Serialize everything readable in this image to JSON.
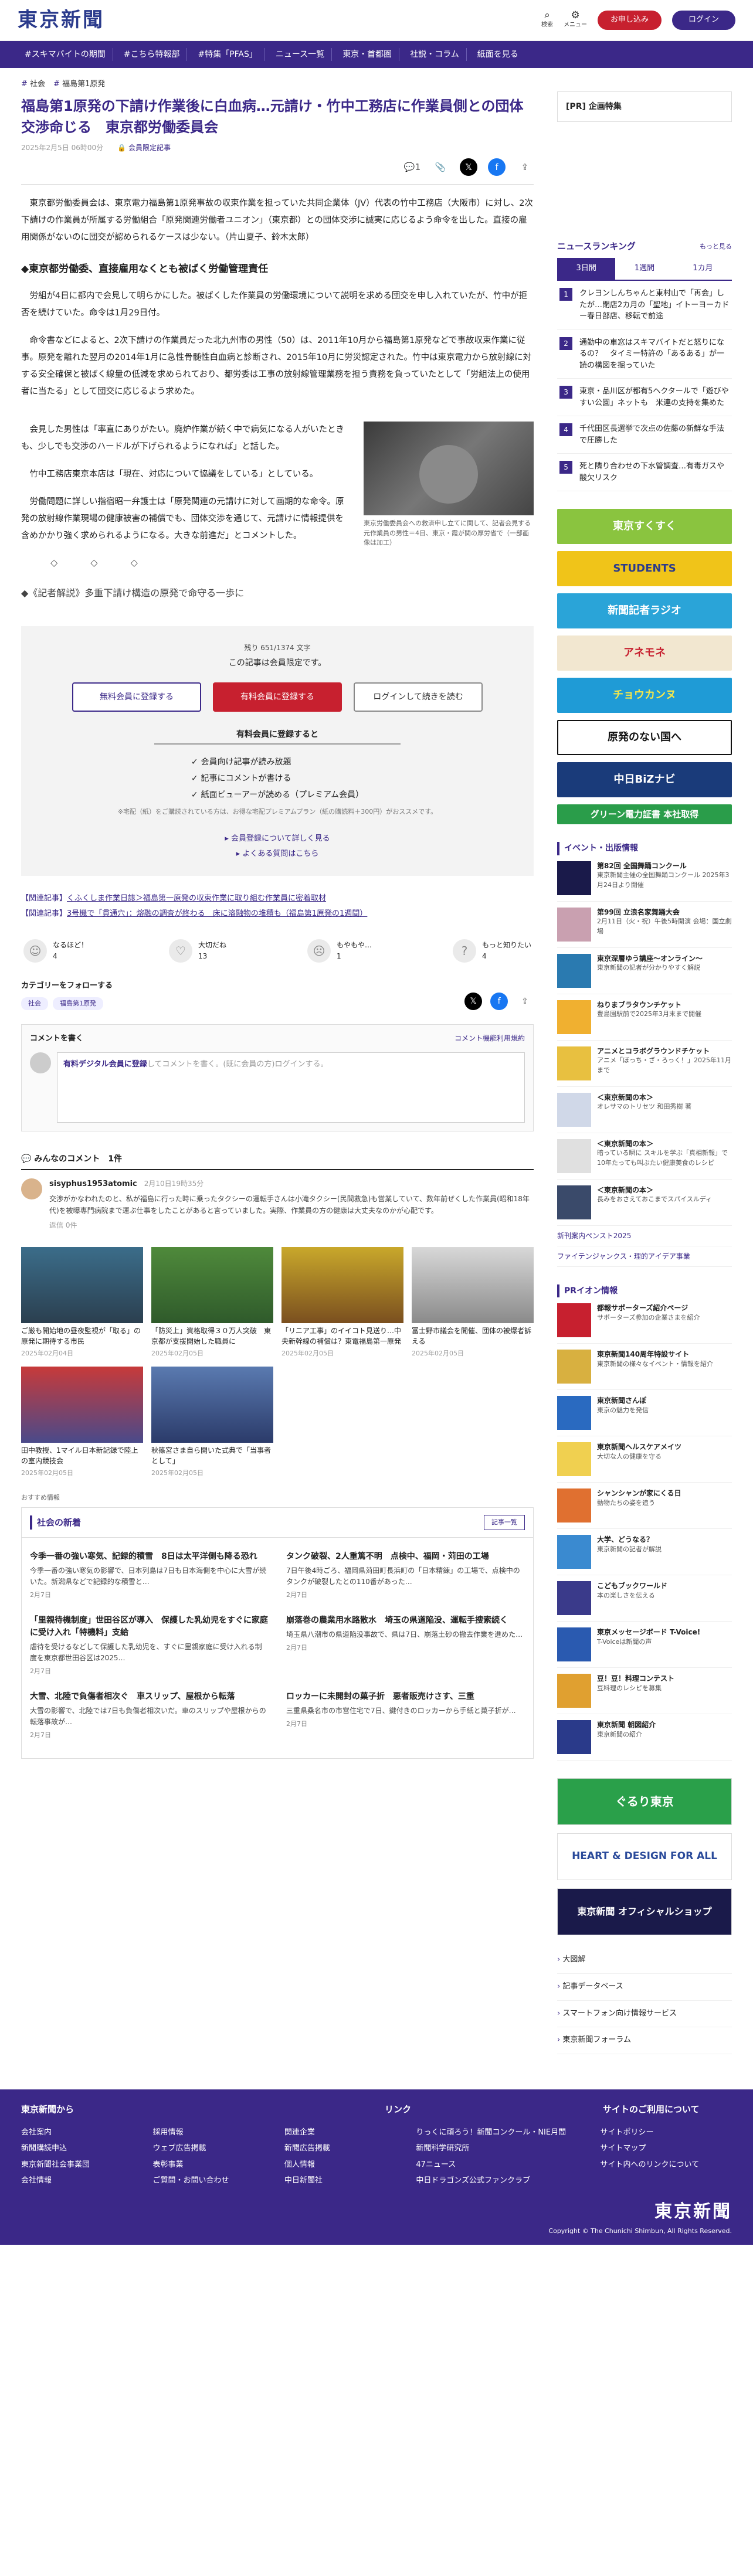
{
  "header": {
    "logo": "東京新聞",
    "search_label": "検索",
    "menu_label": "メニュー",
    "trial_label": "お申し込み",
    "login_label": "ログイン"
  },
  "nav": [
    "#スキマバイトの期間",
    "#こちら特報部",
    "#特集「PFAS」",
    "ニュース一覧",
    "東京・首都圏",
    "社説・コラム",
    "紙面を見る"
  ],
  "article": {
    "breadcrumb": [
      "社会",
      "福島第1原発"
    ],
    "headline": "福島第1原発の下請け作業後に白血病…元請け・竹中工務店に作業員側との団体交渉命じる　東京都労働委員会",
    "date": "2025年2月5日 06時00分",
    "member_badge": "会員限定記事",
    "comment_count": "1",
    "p1": "東京都労働委員会は、東京電力福島第1原発事故の収束作業を担っていた共同企業体（JV）代表の竹中工務店（大阪市）に対し、2次下請けの作業員が所属する労働組合「原発関連労働者ユニオン」（東京都）との団体交渉に誠実に応じるよう命令を出した。直接の雇用関係がないのに団交が認められるケースは少ない。（片山夏子、鈴木太郎）",
    "subhead": "◆東京都労働委、直接雇用なくとも被ばく労働管理責任",
    "p2": "労組が4日に都内で会見して明らかにした。被ばくした作業員の労働環境について説明を求める団交を申し入れていたが、竹中が拒否を続けていた。命令は1月29日付。",
    "p3": "命令書などによると、2次下請けの作業員だった北九州市の男性（50）は、2011年10月から福島第1原発などで事故収束作業に従事。原発を離れた翌月の2014年1月に急性骨髄性白血病と診断され、2015年10月に労災認定された。竹中は東京電力から放射線に対する安全確保と被ばく線量の低減を求められており、都労委は工事の放射線管理業務を担う責務を負っていたとして「労組法上の使用者に当たる」として団交に応じるよう求めた。",
    "p4": "会見した男性は「率直にありがたい。廃炉作業が続く中で病気になる人がいたときも、少しでも交渉のハードルが下げられるようになれば」と話した。",
    "p5": "竹中工務店東京本店は「現在、対応について協議をしている」としている。",
    "p6": "労働問題に詳しい指宿昭一弁護士は「原発関連の元請けに対して画期的な命令。原発の放射線作業現場の健康被害の補償でも、団体交渉を通じて、元請けに情報提供を含めかかり強く求められるようになる。大きな前進だ」とコメントした。",
    "photo_caption": "東京労働委員会への救済申し立てに関して、記者会見する元作業員の男性＝4日、東京・霞が関の厚労省で（一部画像は加工）",
    "dots": "◇　◇　◇",
    "next_section": "◆《記者解説》多重下請け構造の原発で命守る一歩に"
  },
  "paywall": {
    "count": "残り 651/1374 文字",
    "only": "この記事は会員限定です。",
    "btn_free": "無料会員に登録する",
    "btn_paid": "有料会員に登録する",
    "btn_login": "ログインして続きを読む",
    "sub": "有料会員に登録すると",
    "list": [
      "会員向け記事が読み放題",
      "記事にコメントが書ける",
      "紙面ビューアーが読める（プレミアム会員）"
    ],
    "note": "※宅配（紙）をご購読されている方は、お得な宅配プレミアムプラン（紙の購読料＋300円）がおススメです。",
    "link1": "会員登録について詳しく見る",
    "link2": "よくある質問はこちら"
  },
  "related": [
    {
      "tag": "【関連記事】",
      "text": "くふくしま作業日誌＞福島第一原発の収束作業に取り組む作業員に密着取材"
    },
    {
      "tag": "【関連記事】",
      "text": "3号機で「貫通穴」：熔融の調査が終わる　床に溶融物の堆積も（福島第1原発の1週間）"
    }
  ],
  "reactions": [
    {
      "label": "なるほど！",
      "count": "4"
    },
    {
      "label": "大切だね",
      "count": "13"
    },
    {
      "label": "もやもや…",
      "count": "1"
    },
    {
      "label": "もっと知りたい",
      "count": "4"
    }
  ],
  "category": {
    "title": "カテゴリーをフォローする",
    "tags": [
      "社会",
      "福島第1原発"
    ]
  },
  "comment_form": {
    "title": "コメントを書く",
    "rules": "コメント機能利用規約",
    "prompt_pre": "有料デジタル会員に登録",
    "prompt_post": "してコメントを書く。(既に会員の方)ログインする。"
  },
  "comments": {
    "title": "みんなのコメント",
    "count": "1件",
    "items": [
      {
        "user": "sisyphus1953atomic",
        "time": "2月10日19時35分",
        "text": "交渉がかなわれたのと、私が福島に行った時に乗ったタクシーの運転手さんは小滝タクシー(民間救急)も営業していて、数年前ぜくした作業員(昭和18年代)を被曝専門病院まで運ぶ仕事をしたことがあると言っていました。実際、作業員の方の健康は大丈夫なのかが心配です。",
        "likes": "返信 0件"
      }
    ]
  },
  "thumbs": [
    {
      "title": "ご厳も開始地の昼夜監視が「取る」の原発に期待する市民",
      "date": "2025年02月04日"
    },
    {
      "title": "「防災上」資格取得３０万人突破　東京都が支援開始した職員に",
      "date": "2025年02月05日"
    },
    {
      "title": "「リニア工事」のイイコト見送り…中央新幹線の補償は？東電福島第一原発",
      "date": "2025年02月05日"
    },
    {
      "title": "冨士野市議会を開催、団体の被爆者訴える",
      "date": "2025年02月05日"
    },
    {
      "title": "田中教授、1マイル日本新記録で陸上の室内競技会",
      "date": "2025年02月05日"
    },
    {
      "title": "秋篠宮さま自ら開いた式典で「当事者として」",
      "date": "2025年02月05日"
    }
  ],
  "recommend_label": "おすすめ情報",
  "society": {
    "title": "社会の新着",
    "more": "記事一覧",
    "items": [
      {
        "title": "今季一番の強い寒気、記録的積雪　8日は太平洋側も降る恐れ",
        "desc": "今季一番の強い寒気の影響で、日本列島は7日も日本海側を中心に大雪が続いた。新潟県などで記録的な積雪と…",
        "date": "2月7日"
      },
      {
        "title": "タンク破裂、2人重篤不明　点検中、福岡・苅田の工場",
        "desc": "7日午後4時ごろ、福岡県苅田町長浜町の「日本精錬」の工場で、点検中のタンクが破裂したとの110番があった…",
        "date": "2月7日"
      },
      {
        "title": "「里親待機制度」世田谷区が導入　保護した乳幼児をすぐに家庭に受け入れ「特機料」支給",
        "desc": "虐待を受けるなどして保護した乳幼児を、すぐに里親家庭に受け入れる制度を東京都世田谷区は2025…",
        "date": "2月7日"
      },
      {
        "title": "崩落巻の農業用水路散水　埼玉の県道陥没、運転手捜索続く",
        "desc": "埼玉県八潮市の県道陥没事故で、県は7日、崩落土砂の撤去作業を進めた…",
        "date": "2月7日"
      },
      {
        "title": "大雪、北陸で負傷者相次ぐ　車スリップ、屋根から転落",
        "desc": "大雪の影響で、北陸では7日も負傷者相次いだ。車のスリップや屋根からの転落事故が…",
        "date": "2月7日"
      },
      {
        "title": "ロッカーに未開封の菓子折　悪者販売けさす、三重",
        "desc": "三重県桑名市の市営住宅で7日、鍵付きのロッカーから手紙と菓子折が…",
        "date": "2月7日"
      }
    ]
  },
  "sidebar": {
    "pr_title": "[PR] 企画特集",
    "rank_title": "ニュースランキング",
    "rank_more": "もっと見る",
    "rank_tabs": [
      "3日間",
      "1週間",
      "1カ月"
    ],
    "rank_items": [
      "クレヨンしんちゃんと東村山で「再会」したが…閉店2カ月の「聖地」イトーヨーカドー春日部店、移転で前途",
      "通勤中の車窓はスキマバイトだと怒りになるの？　タイミー特許の「あるある」が一読の構図を掘っていた",
      "東京・品川区が都有5ヘクタールで「遊びやすい公園」ネットも　米連の支持を集めた",
      "千代田区長選挙で次点の佐藤の新鮮な手法で圧勝した",
      "死と隣り合わせの下水管調査…有毒ガスや酸欠リスク"
    ],
    "banners": [
      "東京すくすく",
      "STUDENTS",
      "新聞記者ラジオ",
      "アネモネ",
      "チョウカンヌ",
      "原発のない国へ",
      "中日BiZナビ",
      "グリーン電力証書 本社取得"
    ],
    "events_title": "イベント・出版情報",
    "events": [
      {
        "t": "第82回 全国舞踊コンクール",
        "d": "東京新聞主催の全国舞踊コンクール 2025年3月24日より開催"
      },
      {
        "t": "第99回 立浪名家舞踊大会",
        "d": "2月11日（火・祝）午後5時開演 会場：国立劇場"
      },
      {
        "t": "東京深層ゆう講座〜オンライン〜",
        "d": "東京新聞の記者が分かりやすく解説"
      },
      {
        "t": "ねりまブラタウンチケット",
        "d": "豊島園駅前で2025年3月末まで開催"
      },
      {
        "t": "アニメとコラボグラウンドチケット",
        "d": "アニメ「ぼっち・ざ・ろっく！」2025年11月まで"
      },
      {
        "t": "＜東京新聞の本＞",
        "d": "オレサマのトリセツ 和田秀樹 著"
      },
      {
        "t": "＜東京新聞の本＞",
        "d": "暗っている瞬に スキルを学ぶ「真相新報」で10年たっても叫ぶたい健康美食のレシピ"
      },
      {
        "t": "＜東京新聞の本＞",
        "d": "長みをおさえておこまでスパイスルディ"
      }
    ],
    "small_links": [
      "新刊案内ペンスト2025",
      "ファイテンジャンクス・理的アイデア事業"
    ],
    "pr_events_title": "PRイオン情報",
    "pr_events": [
      {
        "t": "都報サポーターズ紹介ページ",
        "d": "サポーターズ参加の企業さまを紹介"
      },
      {
        "t": "東京新聞140周年特設サイト",
        "d": "東京新聞の様々なイベント・情報を紹介"
      },
      {
        "t": "東京新聞さんぽ",
        "d": "東京の魅力を発信"
      },
      {
        "t": "東京新聞ヘルスケアメイツ",
        "d": "大切な人の健康を守る"
      },
      {
        "t": "シャンシャンが家にくる日",
        "d": "動物たちの姿を追う"
      },
      {
        "t": "大学、どうなる？",
        "d": "東京新聞の記者が解説"
      },
      {
        "t": "こどもブックワールド",
        "d": "本の楽しさを伝える"
      },
      {
        "t": "東京メッセージボード T-Voice!",
        "d": "T-Voiceは新聞の声"
      },
      {
        "t": "豆！豆！料理コンテスト",
        "d": "豆料理のレシピを募集"
      },
      {
        "t": "東京新聞 朝図紹介",
        "d": "東京新聞の紹介"
      }
    ],
    "big_banners": [
      "ぐるり東京",
      "HEART & DESIGN FOR ALL",
      "東京新聞 オフィシャルショップ"
    ],
    "side_list": [
      "大図解",
      "記事データベース",
      "スマートフォン向け情報サービス",
      "東京新聞フォーラム"
    ]
  },
  "footer": {
    "left_title": "東京新聞から",
    "mid_title": "リンク",
    "right_title": "サイトのご利用について",
    "cols": [
      [
        "会社案内",
        "新聞購読申込",
        "東京新聞社会事業団",
        "会社情報"
      ],
      [
        "採用情報",
        "ウェブ広告掲載",
        "表彰事業",
        "ご質問・お問い合わせ"
      ],
      [
        "関連企業",
        "新聞広告掲載",
        "個人情報",
        "中日新聞社"
      ],
      [
        "りっくに頑ろう！新聞コンクール・NIE月間",
        "新聞科学研究所",
        "47ニュース",
        "中日ドラゴンズ公式ファンクラブ"
      ],
      [
        "サイトポリシー",
        "サイトマップ",
        "サイト内へのリンクについて"
      ]
    ],
    "logo": "東京新聞",
    "copy": "Copyright © The Chunichi Shimbun, All Rights Reserved."
  }
}
